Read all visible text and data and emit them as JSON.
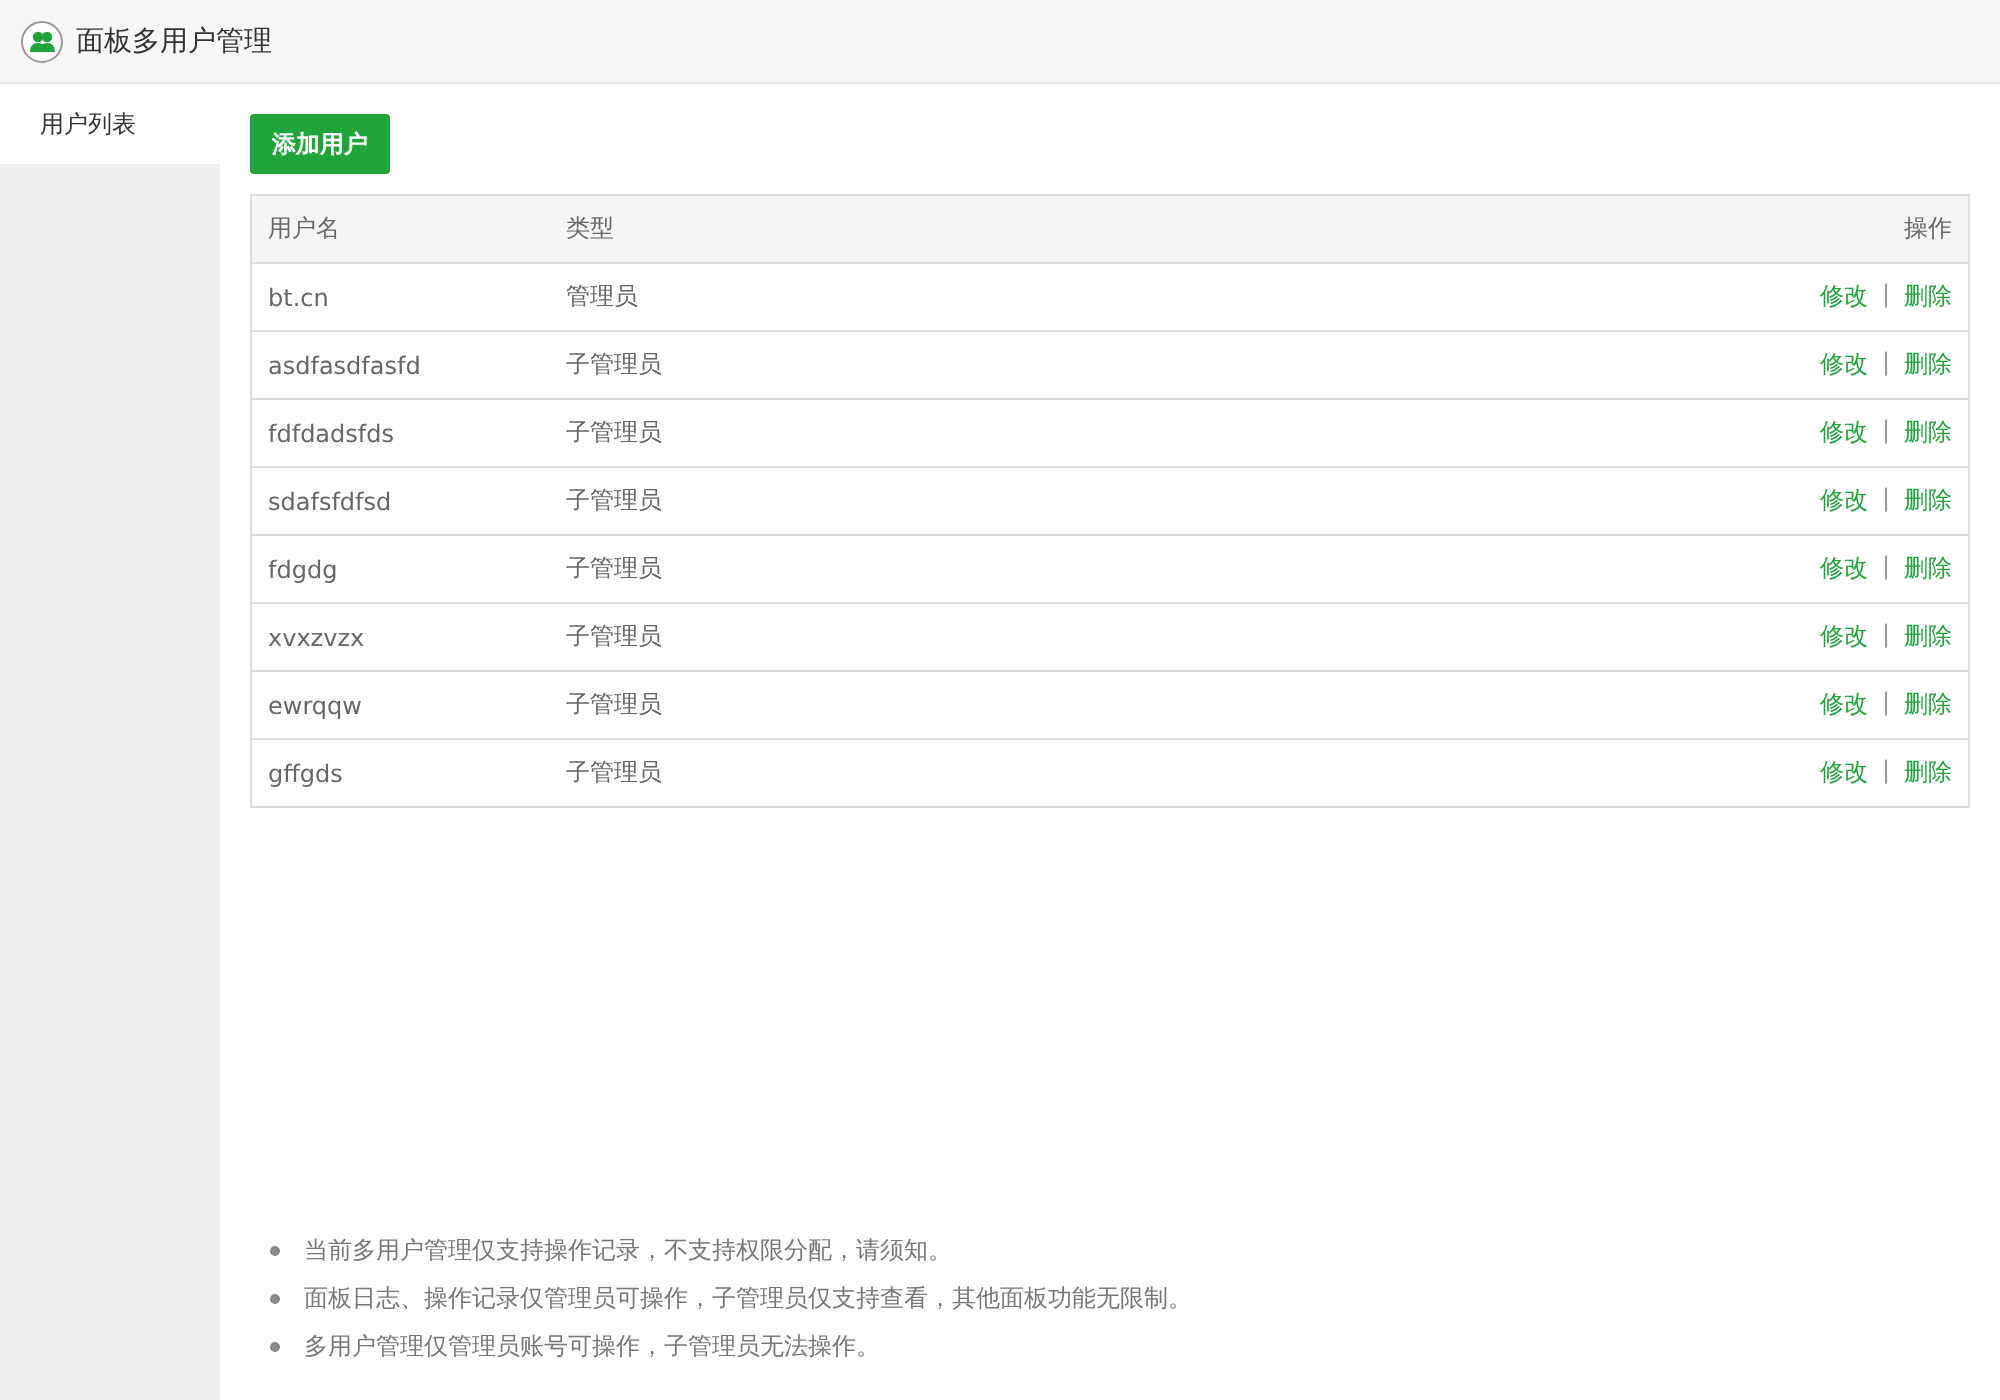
{
  "window": {
    "title": "面板多用户管理"
  },
  "sidebar": {
    "items": [
      {
        "label": "用户列表",
        "selected": true
      }
    ]
  },
  "add_button": "添加用户",
  "table": {
    "columns": [
      "用户名",
      "类型",
      "操作"
    ],
    "rows": [
      {
        "username": "bt.cn",
        "type": "管理员",
        "edit": "修改",
        "separator": "|",
        "delete": "删除"
      },
      {
        "username": "asdfasdfasfd",
        "type": "子管理员",
        "edit": "修改",
        "separator": "|",
        "delete": "删除"
      },
      {
        "username": "fdfdadsfds",
        "type": "子管理员",
        "edit": "修改",
        "separator": "|",
        "delete": "删除"
      },
      {
        "username": "sdafsfdfsd",
        "type": "子管理员",
        "edit": "修改",
        "separator": "|",
        "delete": "删除"
      },
      {
        "username": "fdgdg",
        "type": "子管理员",
        "edit": "修改",
        "separator": "|",
        "delete": "删除"
      },
      {
        "username": "xvxzvzx",
        "type": "子管理员",
        "edit": "修改",
        "separator": "|",
        "delete": "删除"
      },
      {
        "username": "ewrqqw",
        "type": "子管理员",
        "edit": "修改",
        "separator": "|",
        "delete": "删除"
      },
      {
        "username": "gffgds",
        "type": "子管理员",
        "edit": "修改",
        "separator": "|",
        "delete": "删除"
      }
    ]
  },
  "notes": [
    "当前多用户管理仅支持操作记录，不支持权限分配，请须知。",
    "面板日志、操作记录仅管理员可操作，子管理员仅支持查看，其他面板功能无限制。",
    "多用户管理仅管理员账号可操作，子管理员无法操作。"
  ]
}
